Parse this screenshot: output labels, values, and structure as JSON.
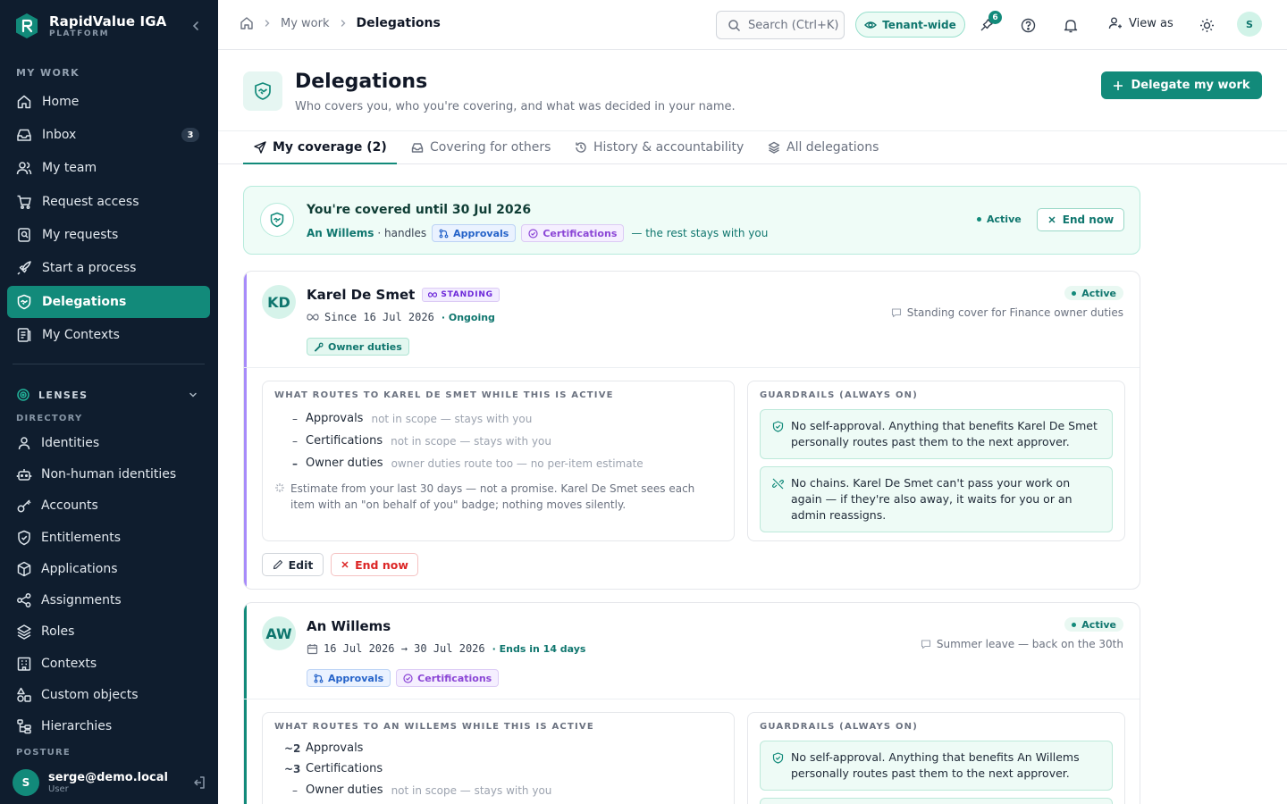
{
  "brand": {
    "name": "RapidValue IGA",
    "sub": "PLATFORM"
  },
  "sidebar": {
    "section_my_work": "MY WORK",
    "items": [
      {
        "label": "Home",
        "icon": "home-icon"
      },
      {
        "label": "Inbox",
        "icon": "inbox-icon",
        "badge": "3"
      },
      {
        "label": "My team",
        "icon": "users-icon"
      },
      {
        "label": "Request access",
        "icon": "cart-icon"
      },
      {
        "label": "My requests",
        "icon": "requests-icon"
      },
      {
        "label": "Start a process",
        "icon": "rocket-icon"
      },
      {
        "label": "Delegations",
        "icon": "shield-handshake-icon",
        "active": true
      },
      {
        "label": "My Contexts",
        "icon": "contexts-icon"
      }
    ],
    "lenses_label": "LENSES",
    "directory_label": "DIRECTORY",
    "directory": [
      {
        "label": "Identities",
        "icon": "person-icon"
      },
      {
        "label": "Non-human identities",
        "icon": "robot-icon"
      },
      {
        "label": "Accounts",
        "icon": "key-icon"
      },
      {
        "label": "Entitlements",
        "icon": "shield-icon"
      },
      {
        "label": "Applications",
        "icon": "box-icon"
      },
      {
        "label": "Assignments",
        "icon": "share-icon"
      },
      {
        "label": "Roles",
        "icon": "layers-icon"
      },
      {
        "label": "Contexts",
        "icon": "building-icon"
      },
      {
        "label": "Custom objects",
        "icon": "shapes-icon"
      },
      {
        "label": "Hierarchies",
        "icon": "hierarchy-icon"
      }
    ],
    "posture_label": "POSTURE",
    "user": {
      "initial": "S",
      "email": "serge@demo.local",
      "role": "User"
    }
  },
  "topbar": {
    "crumbs": [
      "My work",
      "Delegations"
    ],
    "search_placeholder": "Search (Ctrl+K)",
    "tenant_label": "Tenant-wide",
    "notif_badge": "6",
    "view_as": "View as",
    "avatar": "S"
  },
  "page": {
    "title": "Delegations",
    "subtitle": "Who covers you, who you're covering, and what was decided in your name.",
    "primary_action": "Delegate my work"
  },
  "tabs": [
    {
      "label": "My coverage (2)",
      "active": true
    },
    {
      "label": "Covering for others"
    },
    {
      "label": "History & accountability"
    },
    {
      "label": "All delegations"
    }
  ],
  "banner": {
    "title": "You're covered until 30 Jul 2026",
    "who": "An Willems",
    "handles": "· handles",
    "chip1": "Approvals",
    "chip2": "Certifications",
    "rest": "— the rest stays with you",
    "status": "Active",
    "end_label": "End now"
  },
  "cards": [
    {
      "initials": "KD",
      "name": "Karel De Smet",
      "badge": "STANDING",
      "dates": "Since 16 Jul 2026",
      "status_text": "· Ongoing",
      "chip": "Owner duties",
      "active": "Active",
      "note": "Standing cover for Finance owner duties",
      "routes_title": "WHAT ROUTES TO KAREL DE SMET WHILE THIS IS ACTIVE",
      "routes": [
        {
          "marker": "–",
          "label": "Approvals",
          "hint": "not in scope — stays with you"
        },
        {
          "marker": "–",
          "label": "Certifications",
          "hint": "not in scope — stays with you"
        },
        {
          "marker": "–",
          "label": "Owner duties",
          "hint": "owner duties route too — no per-item estimate"
        }
      ],
      "estimate": "Estimate from your last 30 days — not a promise. Karel De Smet sees each item with an \"on behalf of you\" badge; nothing moves silently.",
      "guard_title": "GUARDRAILS (ALWAYS ON)",
      "guard1": "No self-approval. Anything that benefits Karel De Smet personally routes past them to the next approver.",
      "guard2": "No chains. Karel De Smet can't pass your work on again — if they're also away, it waits for you or an admin reassigns.",
      "edit_label": "Edit",
      "end_label": "End now"
    },
    {
      "initials": "AW",
      "name": "An Willems",
      "dates": "16 Jul 2026 → 30 Jul 2026",
      "status_text": "· Ends in 14 days",
      "chip1": "Approvals",
      "chip2": "Certifications",
      "active": "Active",
      "note": "Summer leave — back on the 30th",
      "routes_title": "WHAT ROUTES TO AN WILLEMS WHILE THIS IS ACTIVE",
      "routes": [
        {
          "marker": "~2",
          "label": "Approvals",
          "hint": ""
        },
        {
          "marker": "~3",
          "label": "Certifications",
          "hint": ""
        },
        {
          "marker": "–",
          "label": "Owner duties",
          "hint": "not in scope — stays with you"
        }
      ],
      "guard_title": "GUARDRAILS (ALWAYS ON)",
      "guard1": "No self-approval. Anything that benefits An Willems personally routes past them to the next approver."
    }
  ],
  "colors": {
    "accent": "#128a7a",
    "sidebar_bg": "#0f1d2e",
    "approvals": "#2563c9",
    "certifications": "#8b46d6",
    "standing_stripe": "#a78bfa"
  }
}
